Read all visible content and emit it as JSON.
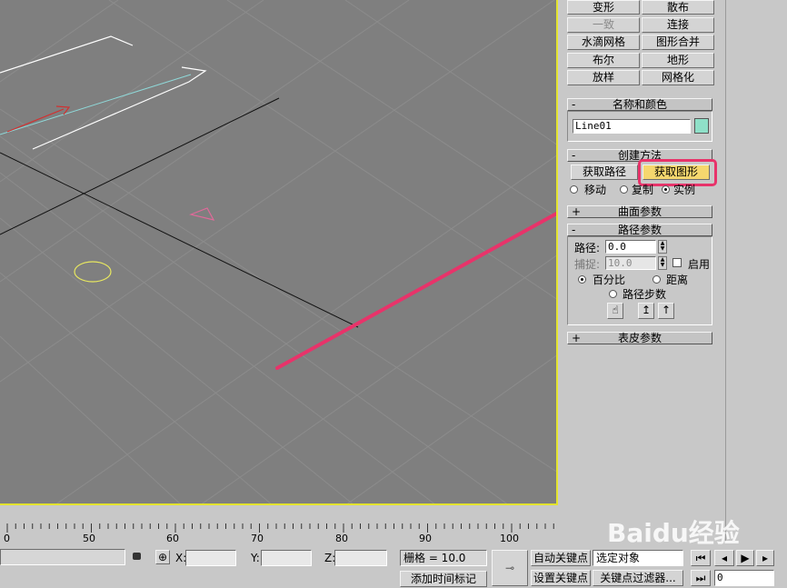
{
  "panel": {
    "modifier_buttons": [
      {
        "label": "变形",
        "disabled": false
      },
      {
        "label": "散布",
        "disabled": false
      },
      {
        "label": "一致",
        "disabled": true
      },
      {
        "label": "连接",
        "disabled": false
      },
      {
        "label": "水滴网格",
        "disabled": false
      },
      {
        "label": "图形合并",
        "disabled": false
      },
      {
        "label": "布尔",
        "disabled": false
      },
      {
        "label": "地形",
        "disabled": false
      },
      {
        "label": "放样",
        "disabled": false
      },
      {
        "label": "网格化",
        "disabled": false
      }
    ],
    "name_color": {
      "title": "名称和颜色",
      "sign": "-",
      "object_name": "Line01",
      "swatch_color": "#8fe0c8"
    },
    "creation_method": {
      "title": "创建方法",
      "sign": "-",
      "get_path_label": "获取路径",
      "get_shape_label": "获取图形",
      "radio_move": "移动",
      "radio_copy": "复制",
      "radio_instance": "实例",
      "selected": "实例"
    },
    "surface_params": {
      "title": "曲面参数",
      "sign": "+"
    },
    "path_params": {
      "title": "路径参数",
      "sign": "-",
      "path_label": "路径:",
      "path_value": "0.0",
      "snap_label": "捕捉:",
      "snap_value": "10.0",
      "enable_label": "启用",
      "percent_label": "百分比",
      "distance_label": "距离",
      "path_steps_label": "路径步数",
      "selected": "百分比"
    },
    "skin_params": {
      "title": "表皮参数",
      "sign": "+"
    }
  },
  "timeline": {
    "ticks": [
      "0",
      "50",
      "60",
      "70",
      "80",
      "90",
      "100"
    ]
  },
  "statusbar": {
    "x_label": "X:",
    "y_label": "Y:",
    "z_label": "Z:",
    "grid_label": "栅格 = 10.0",
    "add_time_tag": "添加时间标记",
    "auto_key": "自动关键点",
    "set_key": "设置关键点",
    "selected_object": "选定对象",
    "key_filters": "关键点过滤器...",
    "frame_value": "0"
  },
  "watermark": "Baidu经验",
  "colors": {
    "viewport_bg": "#7f7f7f",
    "viewport_border": "#e3e32e",
    "highlight": "#e8336a",
    "active_button": "#f5d76e"
  }
}
